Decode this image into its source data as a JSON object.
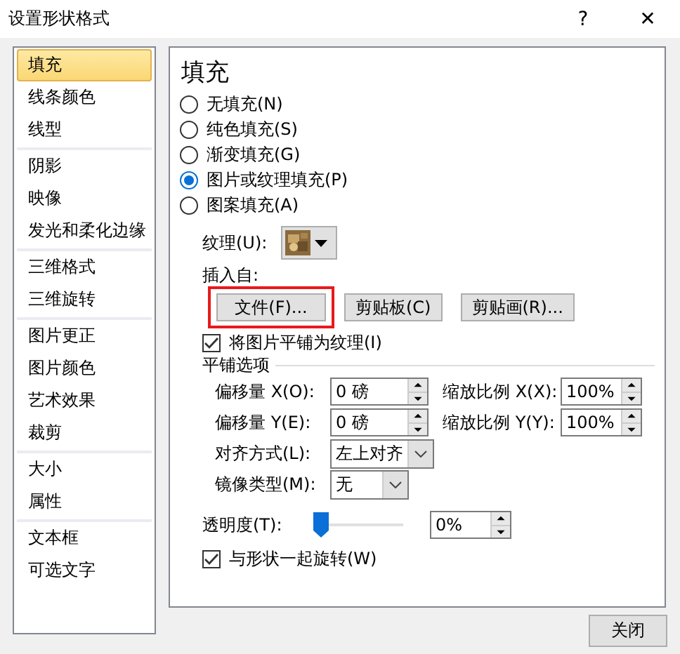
{
  "window": {
    "title": "设置形状格式",
    "help": "?",
    "close": "✕"
  },
  "sidebar": {
    "groups": [
      {
        "items": [
          {
            "label": "填充",
            "selected": true
          },
          {
            "label": "线条颜色",
            "selected": false
          },
          {
            "label": "线型",
            "selected": false
          }
        ]
      },
      {
        "items": [
          {
            "label": "阴影",
            "selected": false
          },
          {
            "label": "映像",
            "selected": false
          },
          {
            "label": "发光和柔化边缘",
            "selected": false
          }
        ]
      },
      {
        "items": [
          {
            "label": "三维格式",
            "selected": false
          },
          {
            "label": "三维旋转",
            "selected": false
          }
        ]
      },
      {
        "items": [
          {
            "label": "图片更正",
            "selected": false
          },
          {
            "label": "图片颜色",
            "selected": false
          },
          {
            "label": "艺术效果",
            "selected": false
          },
          {
            "label": "裁剪",
            "selected": false
          }
        ]
      },
      {
        "items": [
          {
            "label": "大小",
            "selected": false
          },
          {
            "label": "属性",
            "selected": false
          }
        ]
      },
      {
        "items": [
          {
            "label": "文本框",
            "selected": false
          },
          {
            "label": "可选文字",
            "selected": false
          }
        ]
      }
    ]
  },
  "panel": {
    "heading": "填充",
    "fill_options": [
      {
        "label": "无填充(N)",
        "selected": false
      },
      {
        "label": "纯色填充(S)",
        "selected": false
      },
      {
        "label": "渐变填充(G)",
        "selected": false
      },
      {
        "label": "图片或纹理填充(P)",
        "selected": true
      },
      {
        "label": "图案填充(A)",
        "selected": false
      }
    ],
    "texture": {
      "label": "纹理(U):",
      "kind": "picture"
    },
    "insert_from": {
      "label": "插入自:",
      "buttons": [
        {
          "label": "文件(F)...",
          "highlighted": true
        },
        {
          "label": "剪贴板(C)",
          "highlighted": false
        },
        {
          "label": "剪贴画(R)...",
          "highlighted": false
        }
      ]
    },
    "tile_checkbox": {
      "label": "将图片平铺为纹理(I)",
      "checked": true
    },
    "tiling": {
      "title": "平铺选项",
      "spin_rows": [
        {
          "left_label": "偏移量 X(O):",
          "left_value": "0 磅",
          "right_label": "缩放比例 X(X):",
          "right_value": "100%"
        },
        {
          "left_label": "偏移量 Y(E):",
          "left_value": "0 磅",
          "right_label": "缩放比例 Y(Y):",
          "right_value": "100%"
        }
      ],
      "dropdowns": [
        {
          "label": "对齐方式(L):",
          "value": "左上对齐"
        },
        {
          "label": "镜像类型(M):",
          "value": "无"
        }
      ]
    },
    "transparency": {
      "label": "透明度(T):",
      "level": 0,
      "value": "0%"
    },
    "rotate_checkbox": {
      "label": "与形状一起旋转(W)",
      "checked": true
    }
  },
  "footer": {
    "close_button": "关闭"
  }
}
